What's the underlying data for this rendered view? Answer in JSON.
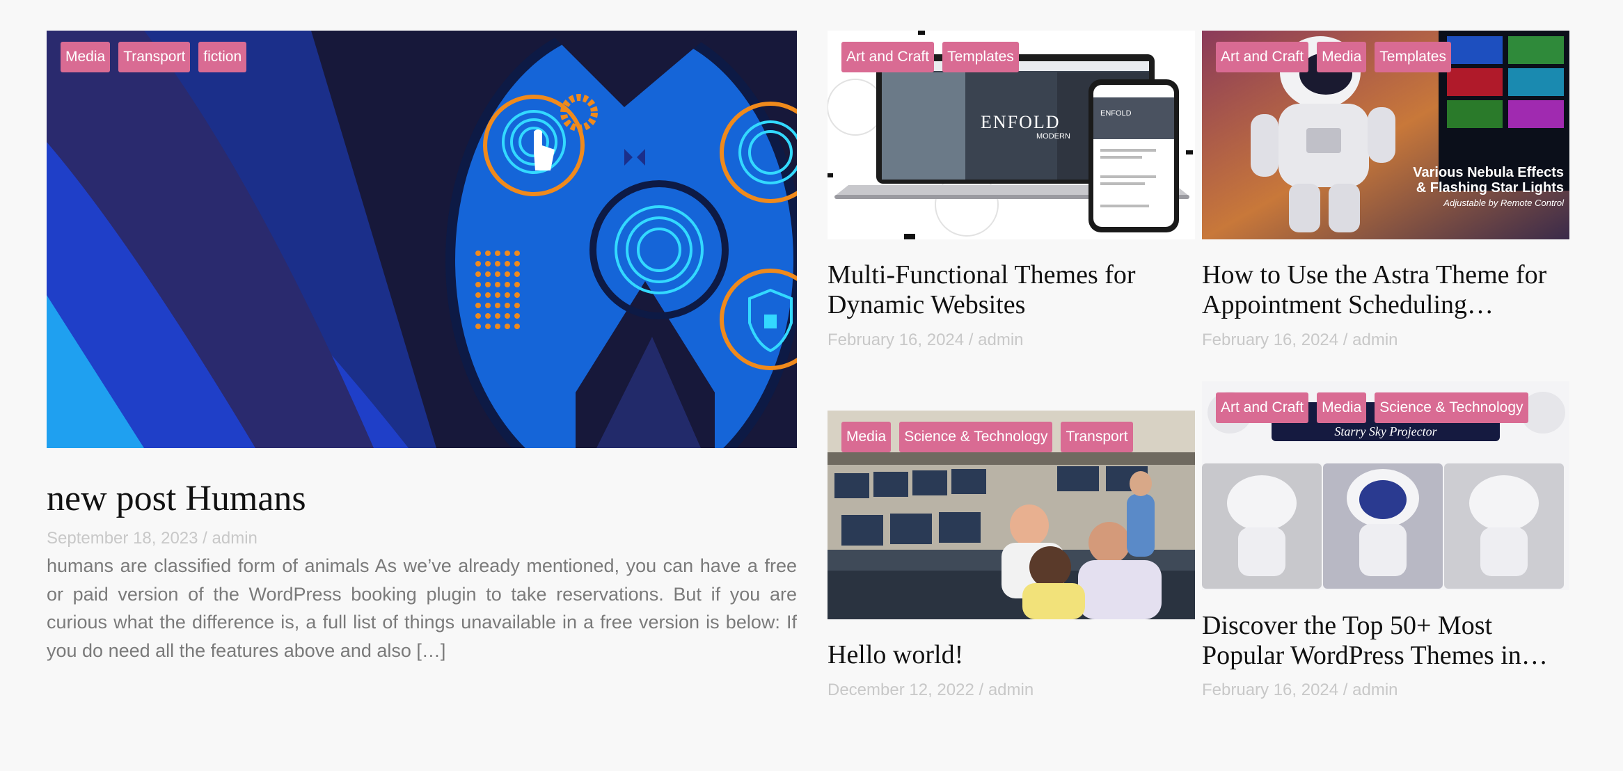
{
  "posts": [
    {
      "tags": [
        "Media",
        "Transport",
        "fiction"
      ],
      "title": "new post Humans",
      "date": "September 18, 2023",
      "author": "admin",
      "excerpt": "humans are classified form of animals As we’ve already mentioned, you can have a free or paid version of the WordPress booking plugin to take reservations. But if you are curious what the difference is, a full list of things unavailable in a free version is below: If you do need all the features above and also […]"
    },
    {
      "tags": [
        "Art and Craft",
        "Templates"
      ],
      "title": "Multi-Functional Themes for Dynamic Websites",
      "date": "February 16, 2024",
      "author": "admin",
      "image_text": {
        "brand": "ENFOLD",
        "sub": "MODERN",
        "phone_brand": "ENFOLD"
      }
    },
    {
      "tags": [
        "Art and Craft",
        "Media",
        "Templates"
      ],
      "title": "How to Use the Astra Theme for Appointment Scheduling…",
      "date": "February 16, 2024",
      "author": "admin",
      "image_text": {
        "line1": "Various Nebula Effects",
        "line2": "& Flashing Star Lights",
        "line3": "Adjustable by Remote Control"
      }
    },
    {
      "tags": [
        "Media",
        "Science & Technology",
        "Transport"
      ],
      "title": "Hello world!",
      "date": "December 12, 2022",
      "author": "admin"
    },
    {
      "tags": [
        "Art and Craft",
        "Media",
        "Science & Technology"
      ],
      "title": "Discover the Top 50+ Most Popular WordPress Themes in…",
      "date": "February 16, 2024",
      "author": "admin",
      "image_text": {
        "banner": "Starry Sky Projector"
      }
    }
  ],
  "meta_separator": " / ",
  "colors": {
    "tag_bg": "#d96b93",
    "meta": "#c8c8c8",
    "excerpt": "#7a7a7a"
  },
  "icons": [
    "fingerprint-icon",
    "gear-icon",
    "shield-lock-icon",
    "hand-pointer-icon"
  ]
}
